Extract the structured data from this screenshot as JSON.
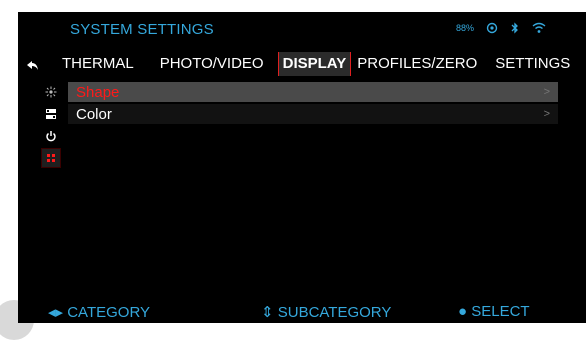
{
  "header": {
    "title": "SYSTEM SETTINGS",
    "battery": "88%"
  },
  "tabs": [
    {
      "label": "THERMAL"
    },
    {
      "label": "PHOTO/VIDEO"
    },
    {
      "label": "DISPLAY"
    },
    {
      "label": "PROFILES/ZERO"
    },
    {
      "label": "SETTINGS"
    }
  ],
  "list": [
    {
      "label": "Shape",
      "chevron": ">"
    },
    {
      "label": "Color",
      "chevron": ">"
    }
  ],
  "footer": {
    "left": "◂▸ CATEGORY",
    "center": "⇕ SUBCATEGORY",
    "right": "● SELECT"
  },
  "colors": {
    "accent": "#35a8dc",
    "selected_text": "#ff1a1a",
    "background": "#000000"
  }
}
